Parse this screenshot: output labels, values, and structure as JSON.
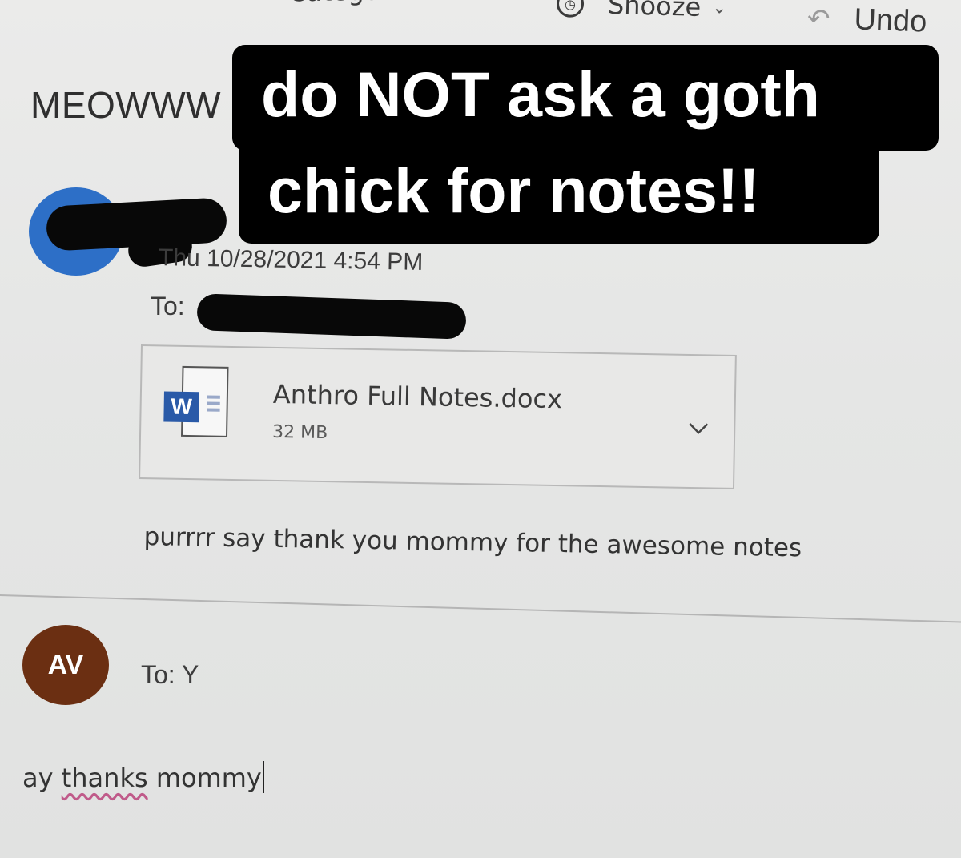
{
  "toolbar": {
    "categorize_label": "Categorize",
    "snooze_label": "Snooze",
    "undo_label": "Undo",
    "icons": [
      "tag-icon",
      "clock-icon",
      "chevron-down-icon",
      "undo-arrow-icon"
    ]
  },
  "message": {
    "subject": "MEOWWW",
    "sent_date": "Thu 10/28/2021 4:54 PM",
    "to_label": "To:",
    "attachment": {
      "file_name": "Anthro Full Notes.docx",
      "file_size": "32 MB",
      "icon": "word-doc-icon"
    },
    "body": "purrrr say thank you mommy for the awesome notes"
  },
  "caption": {
    "line1": "do NOT ask a goth",
    "line2": "chick for notes!!"
  },
  "reply": {
    "avatar_initials": "AV",
    "to_label": "To: Y",
    "text_prefix": "ay ",
    "text_misspelled": "thanks",
    "text_suffix": " mommy"
  },
  "colors": {
    "caption_bg": "#000000",
    "caption_text": "#ffffff",
    "sender_avatar": "#2d6fc7",
    "reply_avatar": "#6b2f12",
    "word_blue": "#2a5aa8",
    "spellcheck_underline": "#c05a8a"
  }
}
